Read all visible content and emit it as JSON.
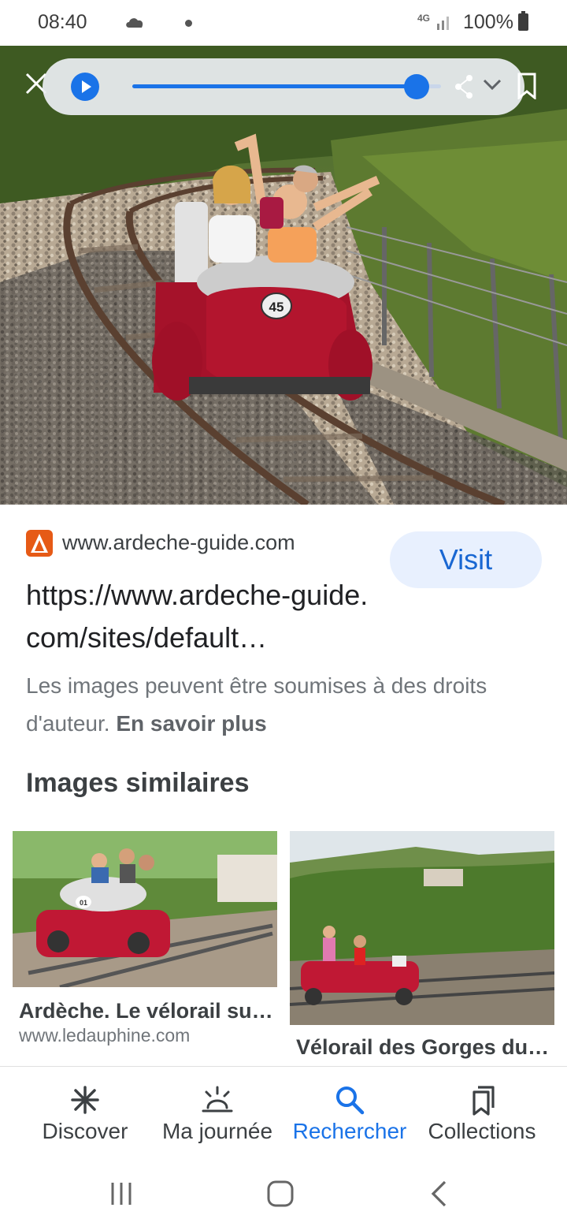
{
  "status_bar": {
    "time": "08:40",
    "network": "4G",
    "battery": "100%",
    "icons": [
      "cloud-icon",
      "notification-dot-icon",
      "signal-icon",
      "battery-icon"
    ]
  },
  "media_bar": {
    "progress": 0.92,
    "icons": [
      "close-icon",
      "play-icon",
      "share-icon",
      "chevron-down-icon",
      "bookmark-icon"
    ]
  },
  "result": {
    "domain": "www.ardeche-guide.com",
    "visit_label": "Visit",
    "url": "https://www.ardeche-guide.com/sites/default…",
    "copyright": "Les images peuvent être soumises à des droits d'auteur.",
    "learn_more": "En savoir plus"
  },
  "similar": {
    "title": "Images similaires",
    "items": [
      {
        "title": "Ardèche. Le vélorail su…",
        "source": "www.ledauphine.com"
      },
      {
        "title": "Vélorail des Gorges du…",
        "source": ""
      }
    ]
  },
  "bottom_nav": {
    "items": [
      {
        "label": "Discover",
        "icon": "discover-icon",
        "active": false
      },
      {
        "label": "Ma journée",
        "icon": "sunrise-icon",
        "active": false
      },
      {
        "label": "Rechercher",
        "icon": "search-icon",
        "active": true
      },
      {
        "label": "Collections",
        "icon": "collections-icon",
        "active": false
      }
    ]
  },
  "colors": {
    "accent": "#1a73e8",
    "visit_bg": "#e8f0fe",
    "source_logo": "#e65a16"
  }
}
